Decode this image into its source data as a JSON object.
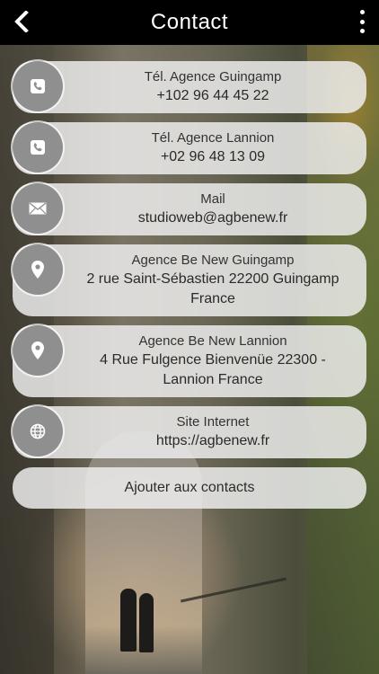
{
  "header": {
    "title": "Contact"
  },
  "contacts": [
    {
      "label": "Tél. Agence Guingamp",
      "value": "+102 96 44 45 22",
      "icon": "phone-icon"
    },
    {
      "label": "Tél. Agence Lannion",
      "value": "+02 96 48 13 09",
      "icon": "phone-icon"
    },
    {
      "label": "Mail",
      "value": "studioweb@agbenew.fr",
      "icon": "mail-icon"
    },
    {
      "label": "Agence Be New Guingamp",
      "value_line1": "2 rue Saint-Sébastien 22200 Guingamp",
      "value_line2": "France",
      "icon": "location-icon"
    },
    {
      "label": "Agence Be New Lannion",
      "value_line1": "4 Rue Fulgence Bienvenüe 22300 -",
      "value_line2": "Lannion France",
      "icon": "location-icon"
    },
    {
      "label": "Site Internet",
      "value": "https://agbenew.fr",
      "icon": "globe-icon"
    }
  ],
  "add_contacts": {
    "label": "Ajouter aux contacts"
  }
}
